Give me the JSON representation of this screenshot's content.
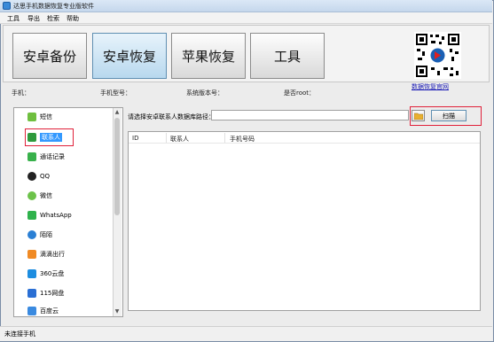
{
  "window": {
    "title": "达思手机数据恢复专业版软件"
  },
  "menu": [
    "工具",
    "导出",
    "检索",
    "帮助"
  ],
  "tabs": [
    "安卓备份",
    "安卓恢复",
    "苹果恢复",
    "工具"
  ],
  "qr_link": "数据恢复官网",
  "info": {
    "phone_label": "手机：",
    "model_label": "手机型号：",
    "os_label": "系统版本号：",
    "root_label": "是否root："
  },
  "sidebar": {
    "items": [
      {
        "label": "短信",
        "icon": "sms-icon",
        "color": "#6fbf3f"
      },
      {
        "label": "联系人",
        "icon": "contacts-icon",
        "color": "#2e9a3c"
      },
      {
        "label": "通话记录",
        "icon": "call-log-icon",
        "color": "#38b14b"
      },
      {
        "label": "QQ",
        "icon": "qq-icon",
        "color": "#222222"
      },
      {
        "label": "微信",
        "icon": "wechat-icon",
        "color": "#6cc24a"
      },
      {
        "label": "WhatsApp",
        "icon": "whatsapp-icon",
        "color": "#2fb24c"
      },
      {
        "label": "陌陌",
        "icon": "momo-icon",
        "color": "#2a7fd4"
      },
      {
        "label": "滴滴出行",
        "icon": "didi-icon",
        "color": "#f08a24"
      },
      {
        "label": "360云盘",
        "icon": "cloud360-icon",
        "color": "#1d8de0"
      },
      {
        "label": "115网盘",
        "icon": "pan115-icon",
        "color": "#2a6fd4"
      },
      {
        "label": "百度云",
        "icon": "baidu-cloud-icon",
        "color": "#3a8ae0"
      }
    ]
  },
  "path": {
    "label": "请选择安卓联系人数据库路径：",
    "value": "",
    "scan_label": "扫描"
  },
  "table": {
    "columns": [
      "ID",
      "联系人",
      "手机号码"
    ],
    "rows": []
  },
  "status": {
    "text": "未连接手机"
  }
}
